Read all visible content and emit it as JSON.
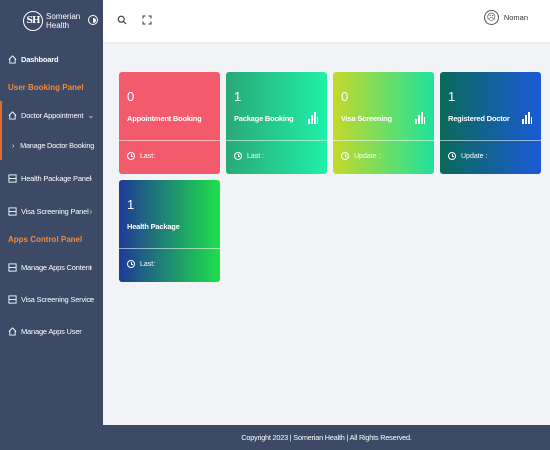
{
  "brand": {
    "initials": "SH",
    "name_line1": "Somerian",
    "name_line2": "Health"
  },
  "sidebar": {
    "dashboard": "Dashboard",
    "section_user_booking": "User Booking Panel",
    "doctor_appointment": "Doctor Appointment",
    "manage_doctor_booking": "Manage Doctor Booking",
    "health_package_panel": "Health Package Panel",
    "visa_screening_panel": "Visa Screening Panel",
    "section_apps_control": "Apps Control Panel",
    "manage_apps_content": "Manage Apps Content",
    "visa_screening_service": "Visa Screening Service",
    "manage_apps_user": "Manage Apps User"
  },
  "header": {
    "user_name": "Noman",
    "icons": [
      "search-icon",
      "fullscreen-icon",
      "user-avatar-icon"
    ]
  },
  "cards": [
    {
      "count": "0",
      "label": "Appointment Booking",
      "footer": "Last:",
      "gradient": [
        "#f35b6c",
        "#f35b6c"
      ],
      "has_chart_icon": false
    },
    {
      "count": "1",
      "label": "Package Booking",
      "footer": "Last :",
      "gradient": [
        "#2aa978",
        "#1ff0a8"
      ],
      "has_chart_icon": true
    },
    {
      "count": "0",
      "label": "Visa Screening",
      "footer": "Update :",
      "gradient": [
        "#c5d92b",
        "#1ee29a"
      ],
      "has_chart_icon": true
    },
    {
      "count": "1",
      "label": "Registered Doctor",
      "footer": "Update :",
      "gradient": [
        "#0a6a58",
        "#1b5ad6"
      ],
      "has_chart_icon": true
    },
    {
      "count": "1",
      "label": "Health Package",
      "footer": "Last:",
      "gradient": [
        "#1f3a96",
        "#1ee04a"
      ],
      "has_chart_icon": false
    }
  ],
  "footer": {
    "copyright": "Copyright 2023 | Somerian Health | All Rights Reserved."
  },
  "colors": {
    "sidebar_bg": "#3c4a66",
    "accent_orange": "#f08a3c",
    "page_bg": "#f2f3f6"
  }
}
